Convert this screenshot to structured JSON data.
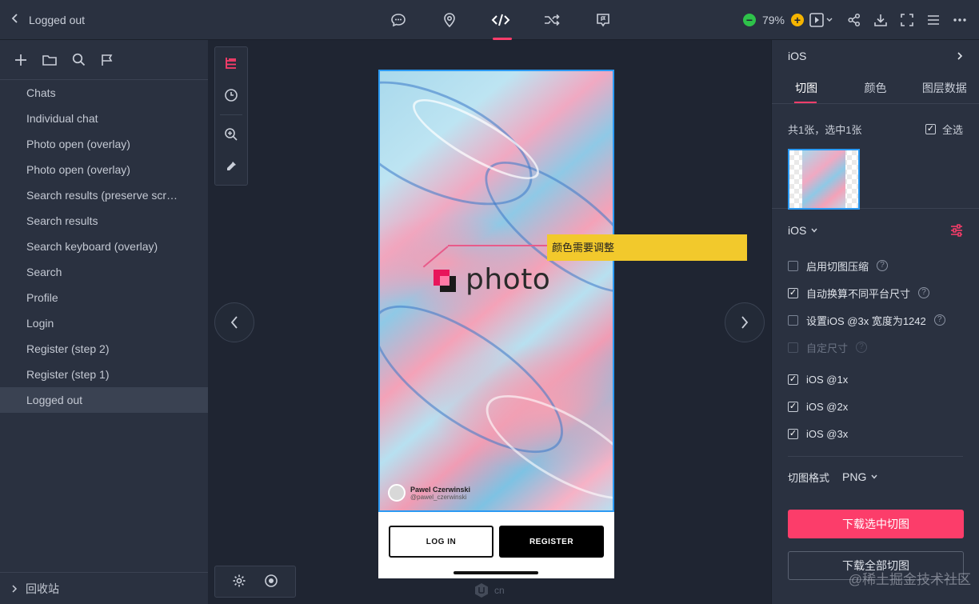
{
  "topbar": {
    "back_label": "Logged out",
    "zoom": "79%",
    "center_tools": [
      "comment-icon",
      "location-icon",
      "code-icon",
      "shuffle-icon",
      "flag-board-icon"
    ],
    "active_tool": "code-icon",
    "accent": "#ff3d6b"
  },
  "sidebar": {
    "pages": [
      "Chats",
      "Individual chat",
      "Photo open (overlay)",
      "Photo open (overlay)",
      "Search results (preserve scr…",
      "Search results",
      "Search keyboard (overlay)",
      "Search",
      "Profile",
      "Login",
      "Register (step 2)",
      "Register (step 1)",
      "Logged out"
    ],
    "active_page": "Logged out",
    "trash_label": "回收站"
  },
  "canvas": {
    "logo_text": "photo",
    "author_name": "Pawel Czerwinski",
    "author_handle": "@pawel_czerwinski",
    "login_label": "LOG IN",
    "register_label": "REGISTER",
    "annotation": "颜色需要调整",
    "watermark": "cn"
  },
  "panel": {
    "platform_header": "iOS",
    "tabs": [
      "切图",
      "颜色",
      "图层数据"
    ],
    "active_tab": "切图",
    "count_text": "共1张，选中1张",
    "select_all": "全选",
    "platform": "iOS",
    "options": [
      {
        "label": "启用切图压缩",
        "checked": false,
        "help": true,
        "disabled": false
      },
      {
        "label": "自动换算不同平台尺寸",
        "checked": true,
        "help": true,
        "disabled": false
      },
      {
        "label": "设置iOS @3x 宽度为1242",
        "checked": false,
        "help": true,
        "disabled": false
      },
      {
        "label": "自定尺寸",
        "checked": false,
        "help": true,
        "disabled": true
      }
    ],
    "scales": [
      {
        "label": "iOS @1x",
        "checked": true
      },
      {
        "label": "iOS @2x",
        "checked": true
      },
      {
        "label": "iOS @3x",
        "checked": true
      }
    ],
    "format_label": "切图格式",
    "format_value": "PNG",
    "download_selected": "下载选中切图",
    "download_all": "下载全部切图",
    "watermark": "@稀土掘金技术社区"
  }
}
